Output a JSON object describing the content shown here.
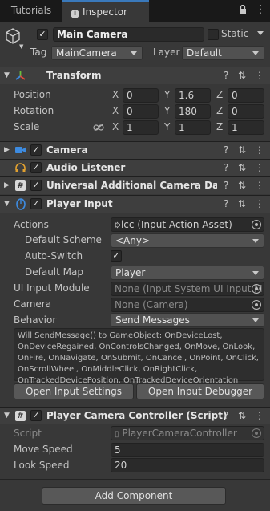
{
  "tabs": {
    "tutorials": "Tutorials",
    "inspector": "Inspector"
  },
  "object": {
    "name": "Main Camera",
    "static_label": "Static",
    "tag_label": "Tag",
    "tag_value": "MainCamera",
    "layer_label": "Layer",
    "layer_value": "Default"
  },
  "transform": {
    "title": "Transform",
    "position_label": "Position",
    "rotation_label": "Rotation",
    "scale_label": "Scale",
    "x": "X",
    "y": "Y",
    "z": "Z",
    "position": {
      "x": "0",
      "y": "1.6",
      "z": "0"
    },
    "rotation": {
      "x": "0",
      "y": "180",
      "z": "0"
    },
    "scale": {
      "x": "1",
      "y": "1",
      "z": "1"
    }
  },
  "components": {
    "camera": "Camera",
    "audio": "Audio Listener",
    "urp": "Universal Additional Camera Data (S",
    "player_input": "Player Input",
    "controller": "Player Camera Controller (Script)"
  },
  "player_input": {
    "actions_label": "Actions",
    "actions_value": "lcc (Input Action Asset)",
    "default_scheme_label": "Default Scheme",
    "default_scheme_value": "<Any>",
    "auto_switch_label": "Auto-Switch",
    "default_map_label": "Default Map",
    "default_map_value": "Player",
    "ui_module_label": "UI Input Module",
    "ui_module_value": "None (Input System UI Input M",
    "camera_label": "Camera",
    "camera_value": "None (Camera)",
    "behavior_label": "Behavior",
    "behavior_value": "Send Messages",
    "info_text": "Will SendMessage() to GameObject: OnDeviceLost, OnDeviceRegained, OnControlsChanged, OnMove, OnLook, OnFire, OnNavigate, OnSubmit, OnCancel, OnPoint, OnClick, OnScrollWheel, OnMiddleClick, OnRightClick, OnTrackedDevicePosition, OnTrackedDeviceOrientation",
    "open_settings": "Open Input Settings",
    "open_debugger": "Open Input Debugger"
  },
  "controller": {
    "script_label": "Script",
    "script_value": "PlayerCameraController",
    "move_label": "Move Speed",
    "move_value": "5",
    "look_label": "Look Speed",
    "look_value": "20"
  },
  "add_component": "Add Component",
  "colors": {
    "accent": "#3a79bb",
    "bg": "#383838",
    "header": "#3e3e3e"
  }
}
